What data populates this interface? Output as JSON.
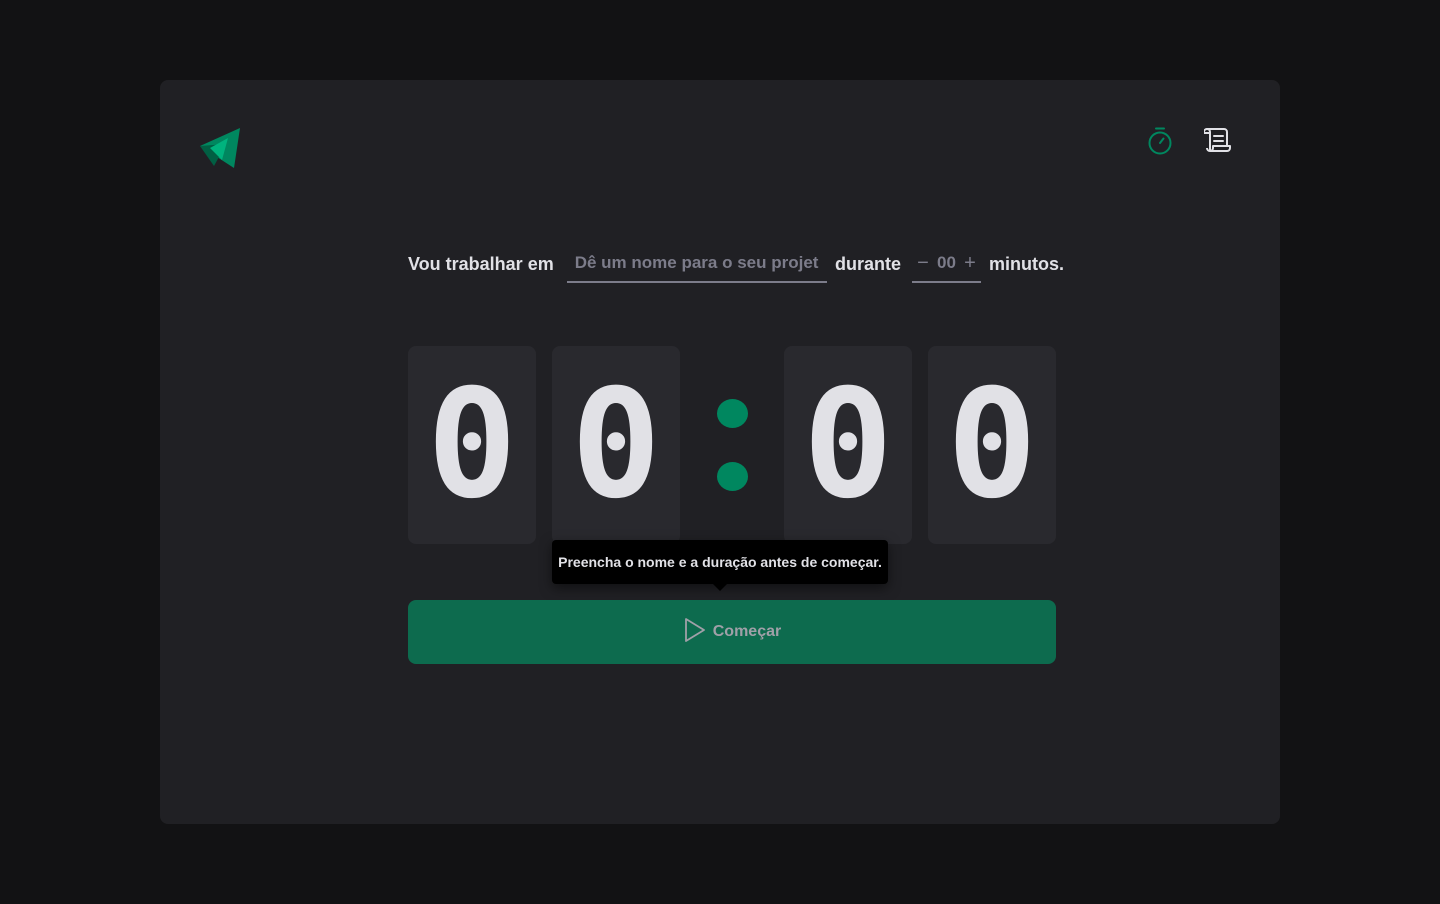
{
  "colors": {
    "page_background": "#121214",
    "card_background": "#202024",
    "digit_background": "#29292e",
    "accent": "#00875f",
    "button_background": "#0d6b4e",
    "text": "#e1e1e6",
    "placeholder": "#7c7c8a"
  },
  "header": {
    "logo_icon": "paper-plane-logo-icon",
    "nav": [
      {
        "icon": "timer-icon",
        "active": true
      },
      {
        "icon": "history-scroll-icon",
        "active": false
      }
    ]
  },
  "form": {
    "label_task": "Vou trabalhar em",
    "task_placeholder": "Dê um nome para o seu projeto",
    "task_value": "",
    "label_duration": "durante",
    "minus_label": "−",
    "plus_label": "+",
    "minutes_placeholder": "00",
    "minutes_value": "",
    "label_minutes": "minutos."
  },
  "countdown": {
    "minutes_tens": "0",
    "minutes_ones": "0",
    "seconds_tens": "0",
    "seconds_ones": "0"
  },
  "tooltip": {
    "text": "Preencha o nome e a duração antes de começar."
  },
  "start_button": {
    "label": "Começar",
    "icon": "play-icon",
    "disabled": true
  }
}
